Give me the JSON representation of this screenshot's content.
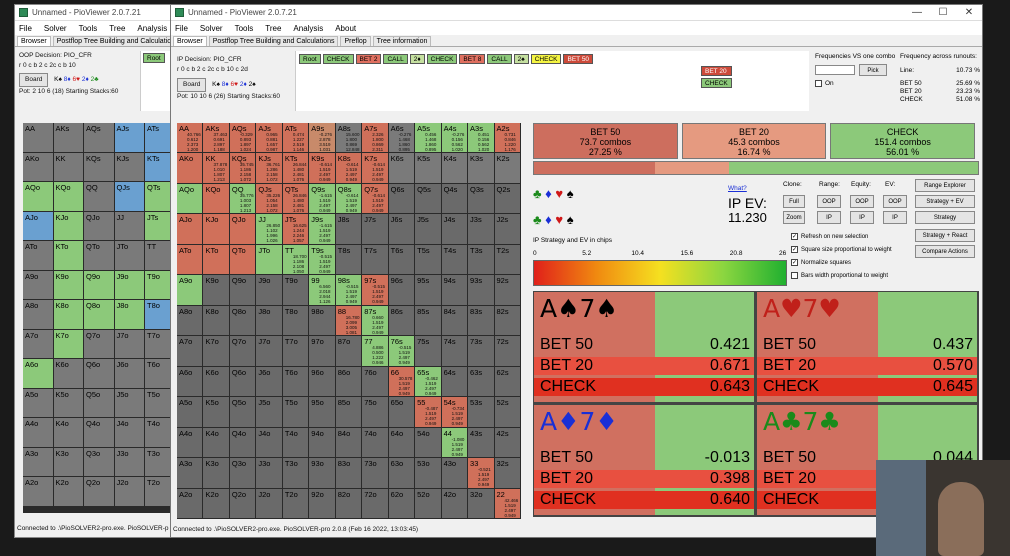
{
  "back_window": {
    "title": "Unnamed - PioViewer 2.0.7.21",
    "menu": [
      "File",
      "Solver",
      "Tools",
      "Tree",
      "Analysis",
      "Abo"
    ],
    "tabs": [
      "Browser",
      "Postflop Tree Building and Calculations"
    ],
    "decision": "OOP Decision: PIO_CFR",
    "board_line": "r 0 c b 2 c 2c c b 10",
    "pot_line": "Pot: 2 10 6 (18) Starting Stacks:60",
    "board_btn": "Board",
    "root_btn": "Root",
    "status": "Connected to .\\PioSOLVER2-pro.exe. PioSOLVER-p",
    "cells": [
      "AA",
      "AKs",
      "AQs",
      "AJs",
      "ATs",
      "AKo",
      "KK",
      "KQs",
      "KJs",
      "KTs",
      "AQo",
      "KQo",
      "QQ",
      "QJs",
      "QTs",
      "AJo",
      "KJo",
      "QJo",
      "JJ",
      "JTs",
      "ATo",
      "KTo",
      "QTo",
      "JTo",
      "TT",
      "A9o",
      "K9o",
      "Q9o",
      "J9o",
      "T9o",
      "A8o",
      "K8o",
      "Q8o",
      "J8o",
      "T8o",
      "A7o",
      "K7o",
      "Q7o",
      "J7o",
      "T7o",
      "A6o",
      "K6o",
      "Q6o",
      "J6o",
      "T6o",
      "A5o",
      "K5o",
      "Q5o",
      "J5o",
      "T5o",
      "A4o",
      "K4o",
      "Q4o",
      "J4o",
      "T4o",
      "A3o",
      "K3o",
      "Q3o",
      "J3o",
      "T3o",
      "A2o",
      "K2o",
      "Q2o",
      "J2o",
      "T2o"
    ]
  },
  "main_window": {
    "title": "Unnamed - PioViewer 2.0.7.21",
    "menu": [
      "File",
      "Solver",
      "Tools",
      "Tree",
      "Analysis",
      "About"
    ],
    "tabs": [
      "Browser",
      "Postflop Tree Building and Calculations",
      "Preflop",
      "Tree information"
    ],
    "decision": "IP Decision: PIO_CFR",
    "board_line": "r 0 c b 2 c 2c c b 10 c 2d",
    "pot_line": "Pot: 10 10 6 (26) Starting Stacks:60",
    "board_btn": "Board",
    "nav": {
      "root": "Root",
      "check1": "CHECK",
      "bet2": "BET 2",
      "call1": "CALL",
      "card1": "2♦",
      "check2": "CHECK",
      "bet8": "BET 8",
      "call2": "CALL",
      "card2": "2♠",
      "check3": "CHECK",
      "opt_bet50": "BET 50",
      "opt_bet20": "BET 20",
      "opt_check": "CHECK"
    },
    "freq_vs_combo": "Frequencies VS one combo",
    "pick_btn": "Pick",
    "on_label": "On",
    "freq_across": "Frequency across runouts:",
    "freq_line_label": "Line:",
    "freq_line_value": "10.73 %",
    "freq_rows": [
      {
        "label": "BET 50",
        "value": "25.69 %"
      },
      {
        "label": "BET 20",
        "value": "23.23 %"
      },
      {
        "label": "CHECK",
        "value": "51.08 %"
      }
    ],
    "strategy": [
      {
        "name": "BET 50",
        "combos": "73.7 combos",
        "pct": "27.25 %",
        "frac": 0.2725,
        "color": "#cd6e5e"
      },
      {
        "name": "BET 20",
        "combos": "45.3 combos",
        "pct": "16.74 %",
        "frac": 0.1674,
        "color": "#e59a80"
      },
      {
        "name": "CHECK",
        "combos": "151.4 combos",
        "pct": "56.01 %",
        "frac": 0.5601,
        "color": "#8cc97a"
      }
    ],
    "what_link": "What?",
    "ev_label": "IP EV:",
    "ev_value": "11.230",
    "clone_label": "Clone:",
    "range_label": "Range:",
    "equity_label": "Equity:",
    "ev_col_label": "EV:",
    "btn_full": "Full",
    "btn_zoom": "Zoom",
    "btn_oop": "OOP",
    "btn_ip": "IP",
    "btn_range_explorer": "Range Explorer",
    "btn_strategy_ev": "Strategy + EV",
    "btn_strategy": "Strategy",
    "btn_strategy_react": "Strategy + React",
    "btn_compare": "Compare Actions",
    "checkboxes": [
      {
        "label": "Refresh on new selection",
        "checked": "✓"
      },
      {
        "label": "Square size proportional to weight",
        "checked": "✓"
      },
      {
        "label": "Normalize squares",
        "checked": "✓"
      },
      {
        "label": "Bars width proportional to weight",
        "checked": ""
      }
    ],
    "gradient_title": "IP Strategy and EV in chips",
    "gradient_ticks": [
      "0",
      "5.2",
      "10.4",
      "15.6",
      "20.8",
      "26"
    ],
    "hand_title": "A7o",
    "suit_combos": [
      {
        "card1": "A♠",
        "card2": "7♠",
        "color": "#000000",
        "rows": [
          [
            "BET 50",
            "0.421"
          ],
          [
            "BET 20",
            "0.671"
          ],
          [
            "CHECK",
            "0.643"
          ]
        ]
      },
      {
        "card1": "A♥",
        "card2": "7♥",
        "color": "#c0201a",
        "rows": [
          [
            "BET 50",
            "0.437"
          ],
          [
            "BET 20",
            "0.570"
          ],
          [
            "CHECK",
            "0.645"
          ]
        ]
      },
      {
        "card1": "A♦",
        "card2": "7♦",
        "color": "#1a2fd6",
        "rows": [
          [
            "BET 50",
            "-0.013"
          ],
          [
            "BET 20",
            "0.398"
          ],
          [
            "CHECK",
            "0.640"
          ]
        ]
      },
      {
        "card1": "A♣",
        "card2": "7♣",
        "color": "#1a8a1a",
        "rows": [
          [
            "BET 50",
            "0.044"
          ],
          [
            "BET 20",
            ""
          ],
          [
            "CHECK",
            ""
          ]
        ]
      }
    ],
    "status": "Connected to .\\PioSOLVER2-pro.exe. PioSOLVER-pro 2.0.8 (Feb 16 2022, 13:03:45)",
    "cell_numbers": {
      "AA": [
        "40.766",
        "0.612",
        "2.373",
        "1.200"
      ],
      "AKs": [
        "37.463",
        "0.691",
        "2.897",
        "1.188"
      ],
      "AQs": [
        "-0.329",
        "0.893",
        "1.897",
        "1.024"
      ],
      "AJs": [
        "0.965",
        "0.881",
        "1.657",
        "0.987"
      ],
      "ATs": [
        "0.474",
        "1.227",
        "2.519",
        "1.146"
      ],
      "A9s": [
        "-0.276",
        "2.878",
        "3.519",
        "1.031"
      ],
      "A8s": [
        "15.600",
        "1.800",
        "0.869",
        "12.848"
      ],
      "A7s": [
        "2.326",
        "1.800",
        "0.869",
        "2.311"
      ],
      "A6s": [
        "-0.276",
        "1.468",
        "1.860",
        "0.895"
      ],
      "A5s": [
        "0.456",
        "1.468",
        "1.860",
        "0.895"
      ],
      "A4s": [
        "-0.276",
        "0.156",
        "0.562",
        "1.020"
      ],
      "A3s": [
        "0.451",
        "0.156",
        "0.562",
        "1.020"
      ],
      "A2s": [
        "0.731",
        "0.846",
        "1.220",
        "1.176"
      ],
      "KK": [
        "37.878",
        "1.010",
        "1.807",
        "1.213"
      ],
      "KQs": [
        "35.745",
        "1.186",
        "2.158",
        "1.072"
      ],
      "KJs": [
        "36.761",
        "1.286",
        "2.158",
        "1.072"
      ],
      "KTs": [
        "26.844",
        "1.480",
        "2.481",
        "1.076"
      ],
      "K9s": [
        "-0.614",
        "1.519",
        "2.497",
        "0.949"
      ],
      "K8s": [
        "-0.614",
        "1.519",
        "2.497",
        "0.949"
      ],
      "K7s": [
        "-0.614",
        "1.519",
        "2.497",
        "0.949"
      ],
      "QQ": [
        "35.776",
        "1.003",
        "1.807",
        "1.213"
      ],
      "QJs": [
        "35.226",
        "1.054",
        "2.158",
        "1.072"
      ],
      "QTs": [
        "26.846",
        "1.480",
        "2.481",
        "1.076"
      ],
      "Q9s": [
        "-1.615",
        "1.519",
        "2.497",
        "0.949"
      ],
      "Q8s": [
        "-0.614",
        "1.519",
        "2.497",
        "0.949"
      ],
      "Q7s": [
        "-0.614",
        "1.519",
        "2.497",
        "0.949"
      ],
      "JJ": [
        "26.850",
        "1.102",
        "1.996",
        "1.026"
      ],
      "JTs": [
        "16.625",
        "1.244",
        "2.246",
        "1.057"
      ],
      "J9s": [
        "-1.615",
        "1.519",
        "2.497",
        "0.949"
      ],
      "TT": [
        "18.700",
        "1.186",
        "2.108",
        "1.050"
      ],
      "T9s": [
        "-0.515",
        "1.519",
        "2.497",
        "0.949"
      ],
      "99": [
        "6.560",
        "2.018",
        "2.944",
        "1.126"
      ],
      "98s": [
        "-0.515",
        "1.519",
        "2.497",
        "0.949"
      ],
      "97s": [
        "-0.515",
        "1.519",
        "2.497",
        "0.949"
      ],
      "88": [
        "16.780",
        "2.099",
        "3.005",
        "1.081"
      ],
      "87s": [
        "0.660",
        "1.519",
        "2.497",
        "0.949"
      ],
      "77": [
        "4.886",
        "0.500",
        "1.222",
        "0.946"
      ],
      "76s": [
        "-0.515",
        "1.519",
        "2.497",
        "0.949"
      ],
      "66": [
        "30.578",
        "1.519",
        "2.497",
        "0.949"
      ],
      "65s": [
        "-0.462",
        "1.519",
        "2.497",
        "0.949"
      ],
      "55": [
        "-0.487",
        "1.519",
        "2.497",
        "0.949"
      ],
      "54s": [
        "-0.734",
        "1.519",
        "2.497",
        "0.949"
      ],
      "44": [
        "-1.080",
        "1.519",
        "2.497",
        "0.949"
      ],
      "33": [
        "-0.521",
        "1.519",
        "2.497",
        "0.949"
      ],
      "22": [
        "42.466",
        "1.519",
        "2.497",
        "0.949"
      ]
    }
  }
}
